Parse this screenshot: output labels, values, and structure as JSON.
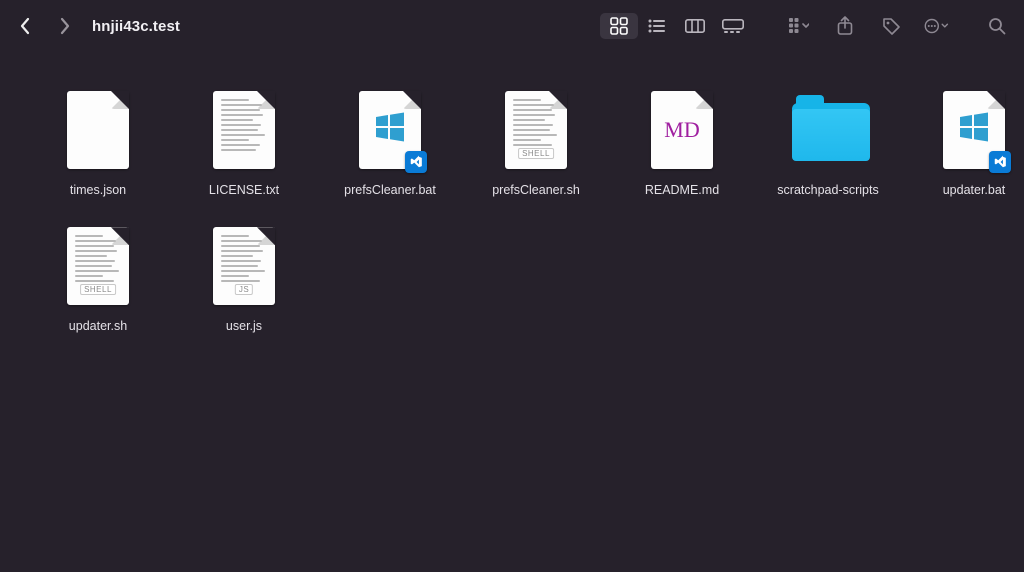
{
  "window": {
    "title": "hnjii43c.test"
  },
  "items": [
    {
      "name": "times.json",
      "type": "blank"
    },
    {
      "name": "LICENSE.txt",
      "type": "text"
    },
    {
      "name": "prefsCleaner.bat",
      "type": "bat"
    },
    {
      "name": "prefsCleaner.sh",
      "type": "shell"
    },
    {
      "name": "README.md",
      "type": "md",
      "md_label": "MD"
    },
    {
      "name": "scratchpad-scripts",
      "type": "folder"
    },
    {
      "name": "updater.bat",
      "type": "bat"
    },
    {
      "name": "updater.sh",
      "type": "shell"
    },
    {
      "name": "user.js",
      "type": "js"
    }
  ],
  "badges": {
    "shell": "SHELL",
    "js": "JS"
  }
}
